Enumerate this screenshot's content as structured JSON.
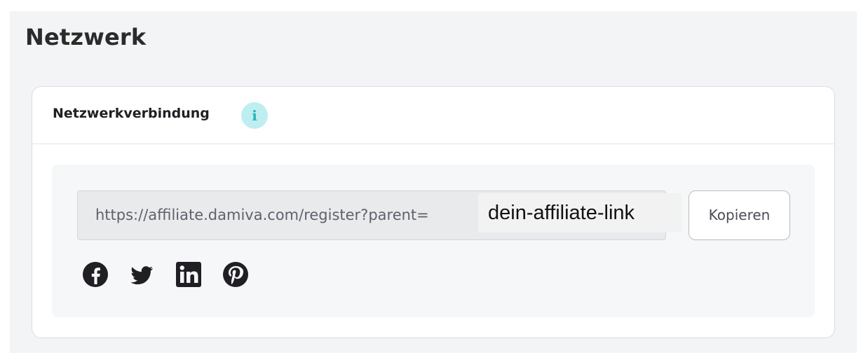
{
  "page": {
    "title": "Netzwerk"
  },
  "card": {
    "title": "Netzwerkverbindung",
    "info_icon": "info-icon",
    "info_glyph": "i"
  },
  "link": {
    "url": "https://affiliate.damiva.com/register?parent=",
    "placeholder_overlay": "dein-affiliate-link"
  },
  "actions": {
    "copy_label": "Kopieren"
  },
  "share": {
    "icons": [
      "facebook-icon",
      "twitter-icon",
      "linkedin-icon",
      "pinterest-icon"
    ]
  },
  "colors": {
    "page_background": "#f3f4f6",
    "card_background": "#ffffff",
    "info_badge": "#bfeef0",
    "info_glyph": "#27b3b8",
    "icon_color": "#1f1f24"
  }
}
